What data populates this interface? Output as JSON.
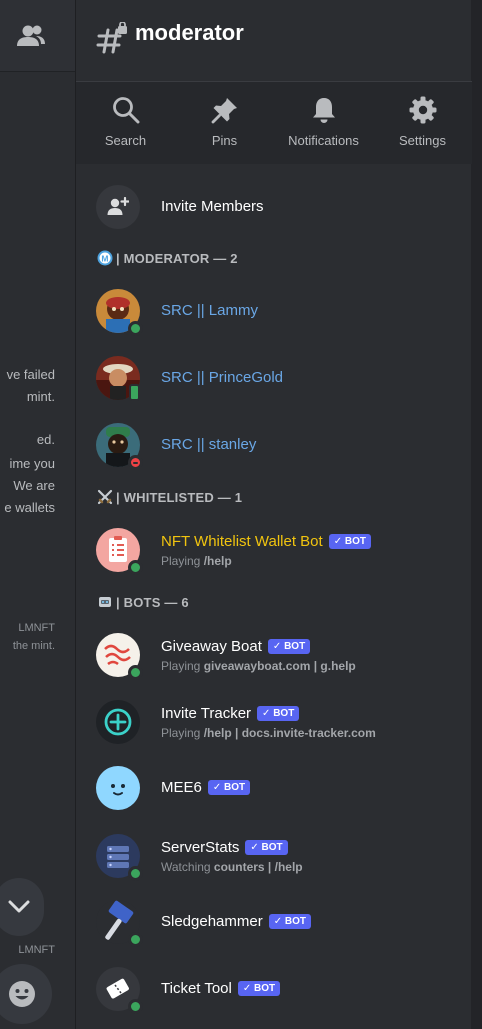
{
  "left_pane": {
    "fragments": [
      "ve failed",
      "mint.",
      "ed.",
      "ime you",
      "We are",
      "e wallets"
    ],
    "footnote1": "LMNFT",
    "footnote1b": "the mint.",
    "footnote2": "LMNFT"
  },
  "header": {
    "channel_name": "moderator"
  },
  "toolbar": {
    "search_label": "Search",
    "pins_label": "Pins",
    "notifications_label": "Notifications",
    "settings_label": "Settings"
  },
  "invite": {
    "label": "Invite Members"
  },
  "sections": {
    "moderator": "| MODERATOR — 2",
    "whitelisted": "| WHITELISTED — 1",
    "bots": "| BOTS — 6"
  },
  "bot_tag": "BOT",
  "moderators": [
    {
      "name": "SRC || Lammy",
      "status": "online"
    },
    {
      "name": "SRC || PrinceGold",
      "status": "mobile"
    },
    {
      "name": "SRC || stanley",
      "status": "dnd"
    }
  ],
  "whitelisted": [
    {
      "name": "NFT Whitelist Wallet Bot",
      "activity_prefix": "Playing",
      "activity_value": "/help",
      "status": "online"
    }
  ],
  "bots": [
    {
      "name": "Giveaway Boat",
      "activity_prefix": "Playing",
      "activity_value": "giveawayboat.com | g.help",
      "status": "online"
    },
    {
      "name": "Invite Tracker",
      "activity_prefix": "Playing",
      "activity_value": "/help | docs.invite-tracker.com",
      "status": "online"
    },
    {
      "name": "MEE6",
      "status": "none"
    },
    {
      "name": "ServerStats",
      "activity_prefix": "Watching",
      "activity_value": "counters | /help",
      "status": "online"
    },
    {
      "name": "Sledgehammer",
      "status": "online"
    },
    {
      "name": "Ticket Tool",
      "status": "online"
    }
  ],
  "colors": {
    "background": "#2b2d31",
    "moderator_name": "#6aa7e6",
    "whitelist_name": "#f1c40f",
    "bot_tag": "#5865f2",
    "online": "#3ba55d",
    "dnd": "#ed4245"
  },
  "icons": {
    "members": "members-icon",
    "channel": "locked-hash-icon",
    "search": "search-icon",
    "pins": "pin-icon",
    "notifications": "bell-icon",
    "settings": "gear-icon",
    "invite": "add-member-icon",
    "scroll": "chevron-down-icon",
    "emoji": "emoji-icon"
  }
}
